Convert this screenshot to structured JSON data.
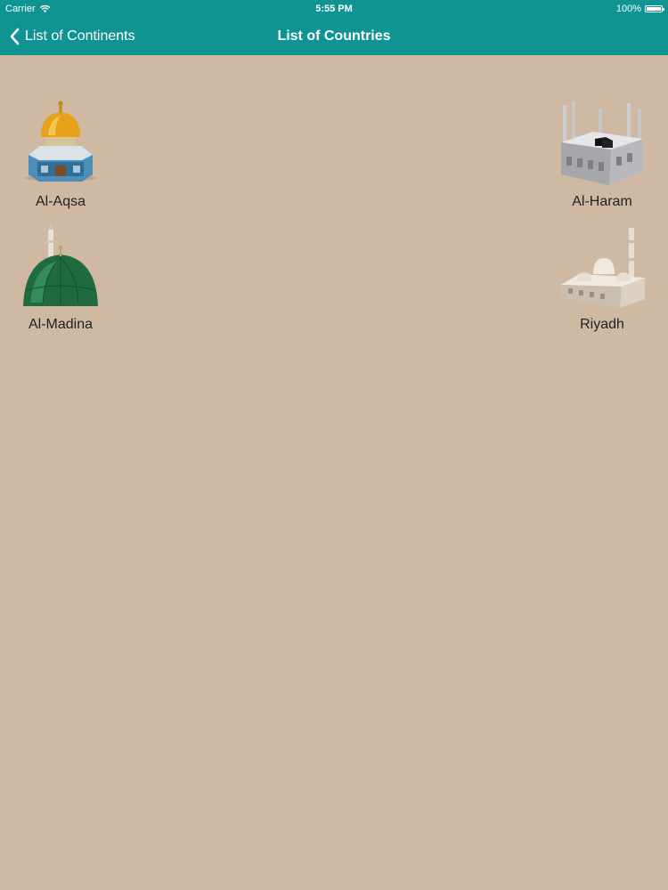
{
  "status_bar": {
    "carrier": "Carrier",
    "time": "5:55 PM",
    "battery": "100%"
  },
  "nav": {
    "back_label": "List of Continents",
    "title": "List of Countries"
  },
  "tiles": [
    {
      "label": "Al-Aqsa",
      "icon": "al-aqsa-dome-icon"
    },
    {
      "label": "Al-Haram",
      "icon": "al-haram-mosque-icon"
    },
    {
      "label": "Al-Madina",
      "icon": "al-madina-green-dome-icon"
    },
    {
      "label": "Riyadh",
      "icon": "riyadh-mosque-icon"
    }
  ],
  "colors": {
    "bar": "#0f9393",
    "background": "#cfb9a3"
  }
}
